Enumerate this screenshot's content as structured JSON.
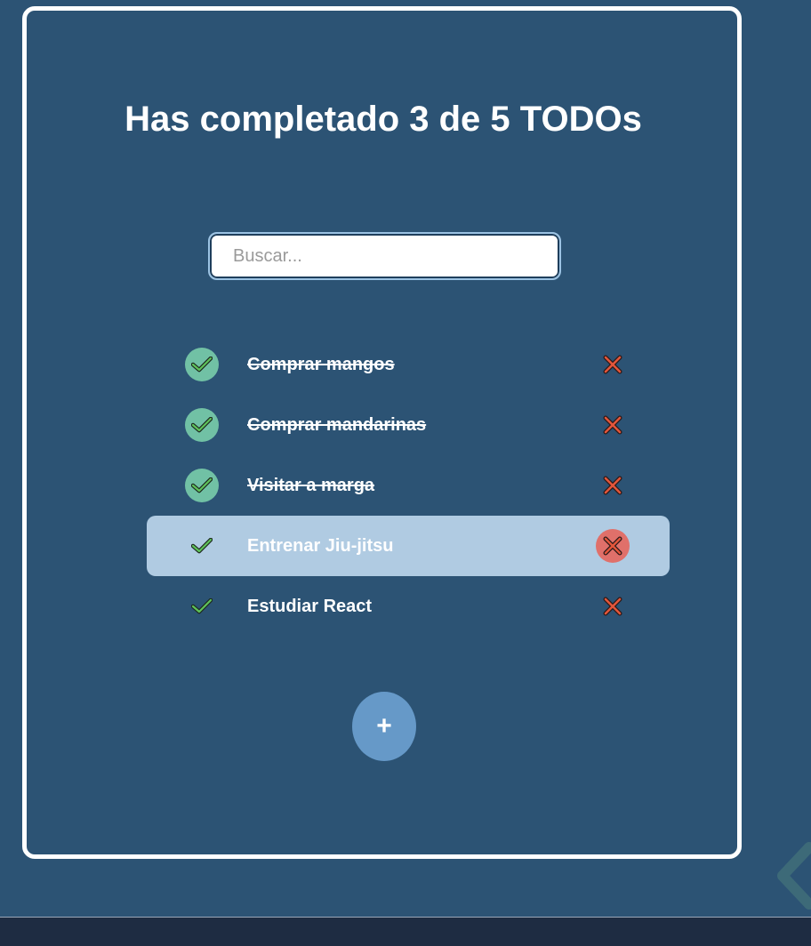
{
  "title": "Has completado 3 de 5 TODOs",
  "search": {
    "placeholder": "Buscar...",
    "value": ""
  },
  "todos": [
    {
      "text": "Comprar mangos",
      "completed": true
    },
    {
      "text": "Comprar mandarinas",
      "completed": true
    },
    {
      "text": "Visitar a marga",
      "completed": true
    },
    {
      "text": "Entrenar Jiu-jitsu",
      "completed": false
    },
    {
      "text": "Estudiar React",
      "completed": false
    }
  ],
  "add_button": {
    "label": "+"
  },
  "colors": {
    "background": "#2c5374",
    "check_done_bg": "#71c1a5",
    "check_mark": "#5fc35a",
    "delete_mark": "#e2553a",
    "hover_row": "#b0cbe2",
    "hover_delete": "#e0706a",
    "add_button": "#6699c8"
  }
}
